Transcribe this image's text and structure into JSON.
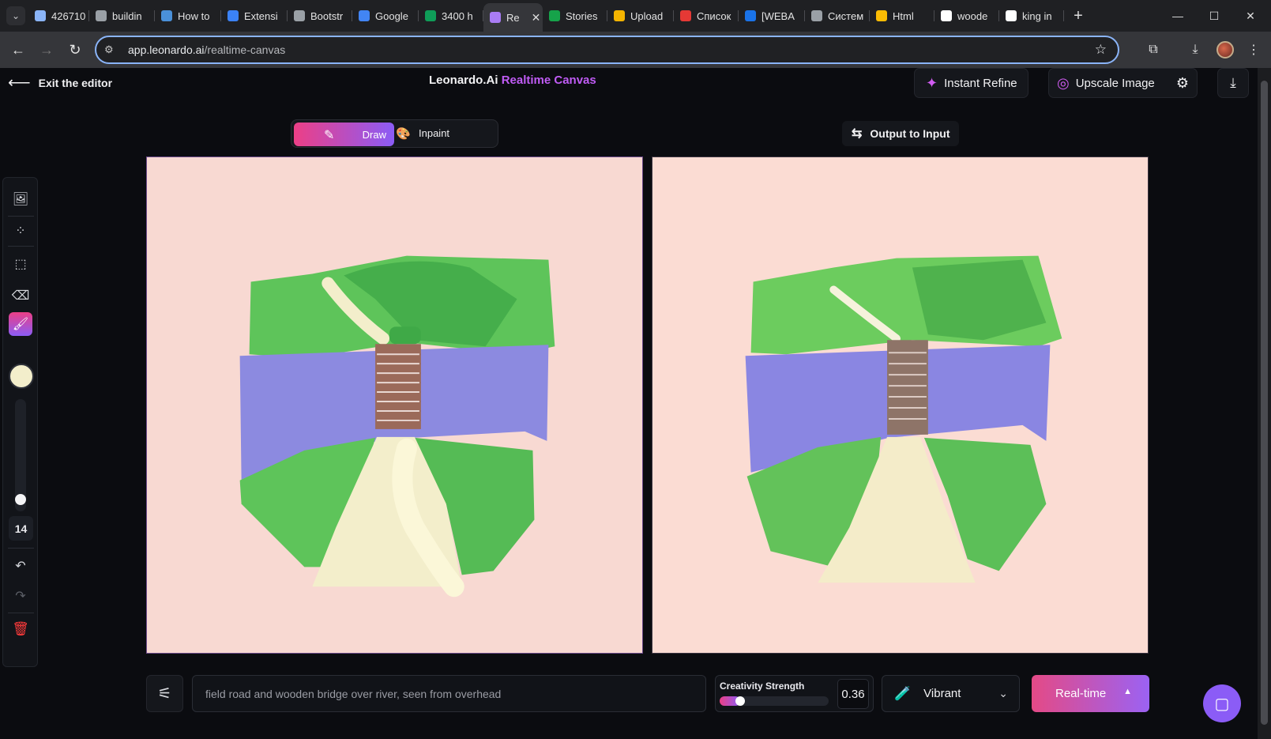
{
  "browser": {
    "tabs": [
      {
        "label": "426710",
        "favicon_color": "#8ab4f8",
        "active": false
      },
      {
        "label": "buildin",
        "favicon_color": "#9aa0a6",
        "active": false
      },
      {
        "label": "How to",
        "favicon_color": "#4a90d9",
        "active": false
      },
      {
        "label": "Extensi",
        "favicon_color": "#3b82f6",
        "active": false
      },
      {
        "label": "Bootstr",
        "favicon_color": "#9aa0a6",
        "active": false
      },
      {
        "label": "Google",
        "favicon_color": "#4285f4",
        "active": false
      },
      {
        "label": "3400 h",
        "favicon_color": "#0f9d58",
        "active": false
      },
      {
        "label": "Re",
        "favicon_color": "#a97cf4",
        "active": true
      },
      {
        "label": "Stories",
        "favicon_color": "#16a34a",
        "active": false
      },
      {
        "label": "Upload",
        "favicon_color": "#f4b400",
        "active": false
      },
      {
        "label": "Список",
        "favicon_color": "#e53935",
        "active": false
      },
      {
        "label": "[WEBA",
        "favicon_color": "#1a73e8",
        "active": false
      },
      {
        "label": "Систем",
        "favicon_color": "#9aa0a6",
        "active": false
      },
      {
        "label": "Html",
        "favicon_color": "#fbbc04",
        "active": false
      },
      {
        "label": "woode",
        "favicon_color": "#ffffff",
        "active": false
      },
      {
        "label": "king in",
        "favicon_color": "#ffffff",
        "active": false
      }
    ],
    "url_host": "app.leonardo.ai",
    "url_path": "/realtime-canvas"
  },
  "header": {
    "exit_label": "Exit the editor",
    "title_main": "Leonardo.Ai",
    "title_accent": "Realtime Canvas",
    "instant_refine": "Instant Refine",
    "upscale_image": "Upscale Image"
  },
  "mode": {
    "draw": "Draw",
    "inpaint": "Inpaint",
    "selected": "Draw"
  },
  "output_to_input": "Output to Input",
  "tools": {
    "brush_size": "14",
    "brush_color": "#f3eecb"
  },
  "bottom": {
    "prompt": "field road and wooden bridge over river, seen from overhead",
    "creativity_label": "Creativity Strength",
    "creativity_value": "0.36",
    "creativity_level": 0.36,
    "style": "Vibrant",
    "realtime": "Real-time"
  },
  "colors": {
    "accent_pink": "#ec3f86",
    "accent_purple": "#8b5cf6",
    "canvas_bg": "#f8d9d2"
  }
}
